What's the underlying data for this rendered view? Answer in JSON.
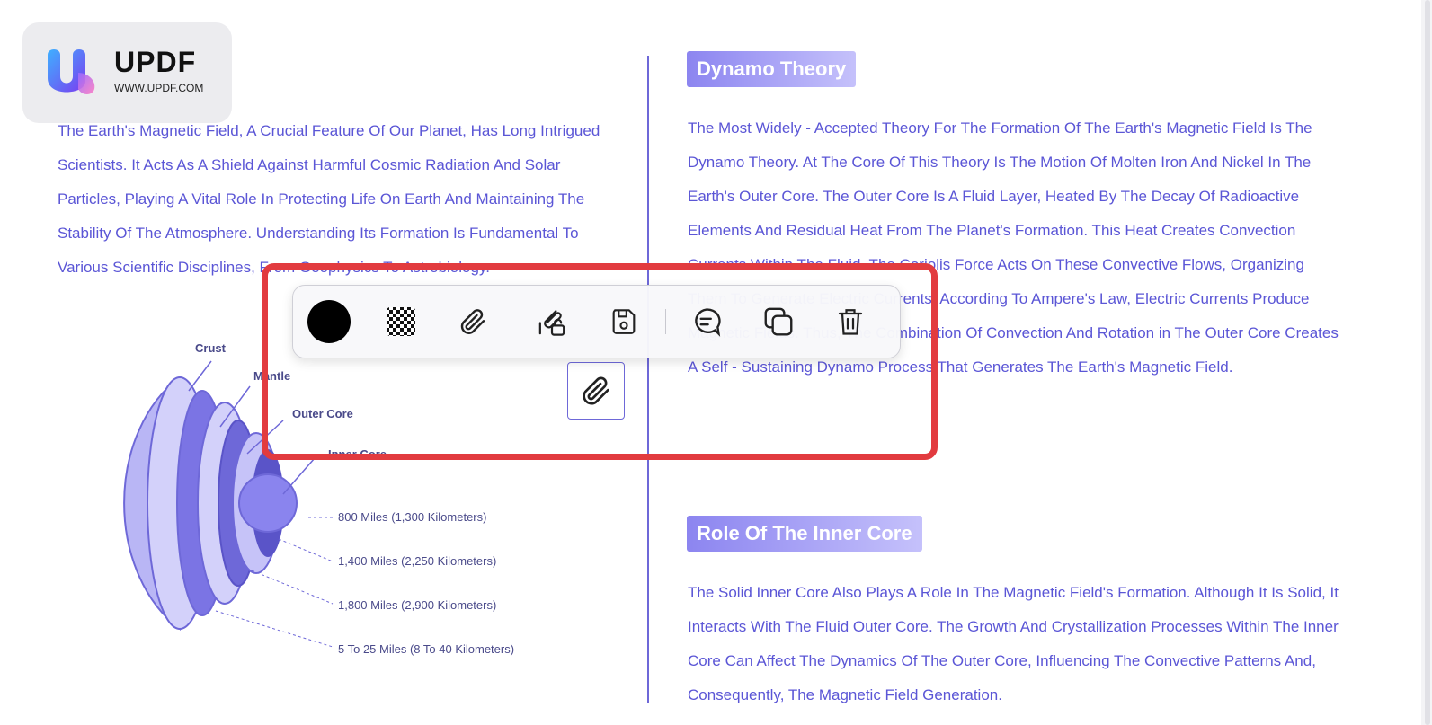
{
  "logo": {
    "name": "UPDF",
    "url": "WWW.UPDF.COM"
  },
  "left_paragraph": "The Earth's Magnetic Field, A Crucial Feature Of Our Planet, Has Long Intrigued Scientists. It Acts As A Shield Against Harmful Cosmic Radiation And Solar Particles, Playing A Vital Role In Protecting Life On Earth And Maintaining The Stability Of The Atmosphere. Understanding Its Formation Is Fundamental To Various Scientific Disciplines, From Geophysics To Astrobiology.",
  "diagram": {
    "labels": {
      "crust": "Crust",
      "mantle": "Mantle",
      "outer_core": "Outer Core",
      "inner_core": "Inner Core"
    },
    "distances": [
      "800 Miles (1,300 Kilometers)",
      "1,400 Miles (2,250 Kilometers)",
      "1,800 Miles (2,900 Kilometers)",
      "5 To 25 Miles (8 To 40 Kilometers)"
    ]
  },
  "sections": [
    {
      "heading": "Dynamo Theory",
      "text": "The Most Widely - Accepted Theory For The Formation Of The Earth's Magnetic Field Is The Dynamo Theory. At The Core Of This Theory Is The Motion Of Molten Iron And Nickel In The Earth's Outer Core. The Outer Core Is A Fluid Layer, Heated By The Decay Of Radioactive Elements And Residual Heat From The Planet's Formation. This Heat Creates Convection Currents Within The Fluid. The Coriolis Force Acts On These Convective Flows, Organizing Them To Generate Electric Currents. According To Ampere's Law, Electric Currents Produce Magnetic Fields. Thus, The Combination Of Convection And Rotation in The Outer Core Creates A Self - Sustaining Dynamo Process That Generates The Earth's Magnetic Field."
    },
    {
      "heading": "Role Of The Inner Core",
      "text": "The Solid Inner Core Also Plays A Role In The Magnetic Field's Formation. Although It Is Solid, It Interacts With The Fluid Outer Core. The Growth And Crystallization Processes Within The Inner Core Can Affect The Dynamics Of The Outer Core, Influencing The Convective Patterns And, Consequently, The Magnetic Field Generation."
    }
  ],
  "toolbar": {
    "color": "#000000",
    "tools": [
      "color-swatch",
      "opacity-icon",
      "paperclip-icon",
      "attachment-open-icon",
      "save-icon",
      "comment-icon",
      "copy-icon",
      "trash-icon"
    ]
  },
  "colors": {
    "text": "#5b56d6",
    "highlight": "#e23b3f",
    "heading_bg": "#8c85f0"
  }
}
